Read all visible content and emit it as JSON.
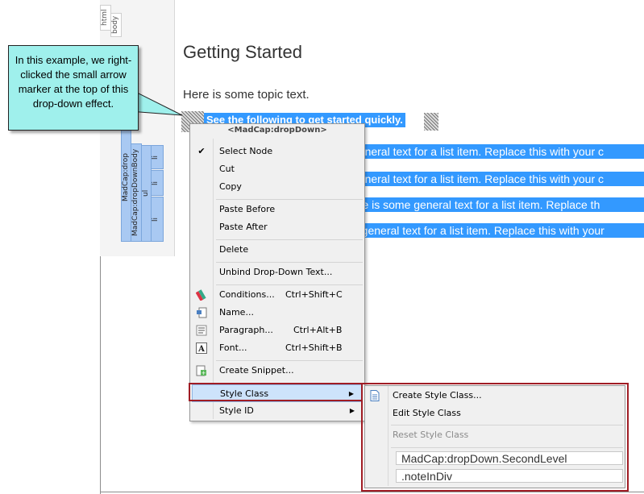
{
  "callout": {
    "text": "In this example, we right-clicked the small arrow marker at the top of this drop-down effect."
  },
  "structure_bar": {
    "tags": [
      "html",
      "body",
      "MadCap:drop",
      "MadCap:dropDownBody",
      "ul",
      "li",
      "li",
      "li"
    ]
  },
  "document": {
    "title": "Getting Started",
    "topic_text": "Here is some topic text.",
    "hotspot_text": "See the following to get started quickly.",
    "list_items": [
      "general text for a list item. Replace this with your c",
      "general text for a list item. Replace this with your c",
      "ere is some general text for a list item. Replace th",
      "e general text for a list item. Replace this with your"
    ]
  },
  "context_menu": {
    "header": "<MadCap:dropDown>",
    "items": [
      {
        "label": "Select Node",
        "icon": "checkmark-icon",
        "checked": true
      },
      {
        "label": "Cut"
      },
      {
        "label": "Copy"
      },
      {
        "label": "Paste Before"
      },
      {
        "label": "Paste After"
      },
      {
        "label": "Delete"
      },
      {
        "label": "Unbind Drop-Down Text..."
      },
      {
        "label": "Conditions...",
        "shortcut": "Ctrl+Shift+C",
        "icon": "conditions-icon"
      },
      {
        "label": "Name...",
        "icon": "name-icon"
      },
      {
        "label": "Paragraph...",
        "shortcut": "Ctrl+Alt+B",
        "icon": "paragraph-icon"
      },
      {
        "label": "Font...",
        "shortcut": "Ctrl+Shift+B",
        "icon": "font-icon"
      },
      {
        "label": "Create Snippet...",
        "icon": "snippet-icon"
      },
      {
        "label": "Style Class",
        "submenu": true,
        "highlighted": true
      },
      {
        "label": "Style ID",
        "submenu": true
      }
    ]
  },
  "style_class_submenu": {
    "create": "Create Style Class...",
    "edit": "Edit Style Class",
    "reset": "Reset Style Class",
    "classes": [
      "MadCap:dropDown.SecondLevel",
      ".noteInDiv"
    ]
  },
  "colors": {
    "selection": "#3399ff",
    "callout_fill": "#9ff0ec",
    "highlight_frame": "#a01c24",
    "menu_bg": "#f0f0f0"
  }
}
